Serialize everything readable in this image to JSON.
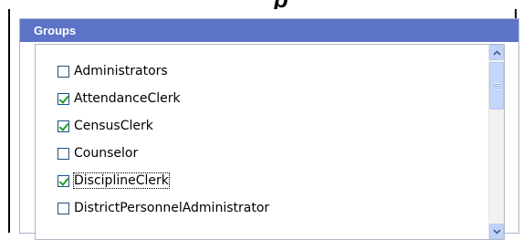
{
  "page": {
    "cropped_heading": "p"
  },
  "groups_panel": {
    "title": "Groups",
    "items": [
      {
        "label": "Administrators",
        "checked": false
      },
      {
        "label": "AttendanceClerk",
        "checked": true
      },
      {
        "label": "CensusClerk",
        "checked": true
      },
      {
        "label": "Counselor",
        "checked": false
      },
      {
        "label": "DisciplineClerk",
        "checked": true
      },
      {
        "label": "DistrictPersonnelAdministrator",
        "checked": false
      }
    ],
    "scrollbar": {
      "up_icon": "chevron-up-icon",
      "down_icon": "chevron-down-icon"
    }
  },
  "colors": {
    "header_bg": "#5d73c7",
    "header_text": "#ffffff",
    "check_mark": "#21a121",
    "scrollbar_button": "#c1d3fb"
  }
}
